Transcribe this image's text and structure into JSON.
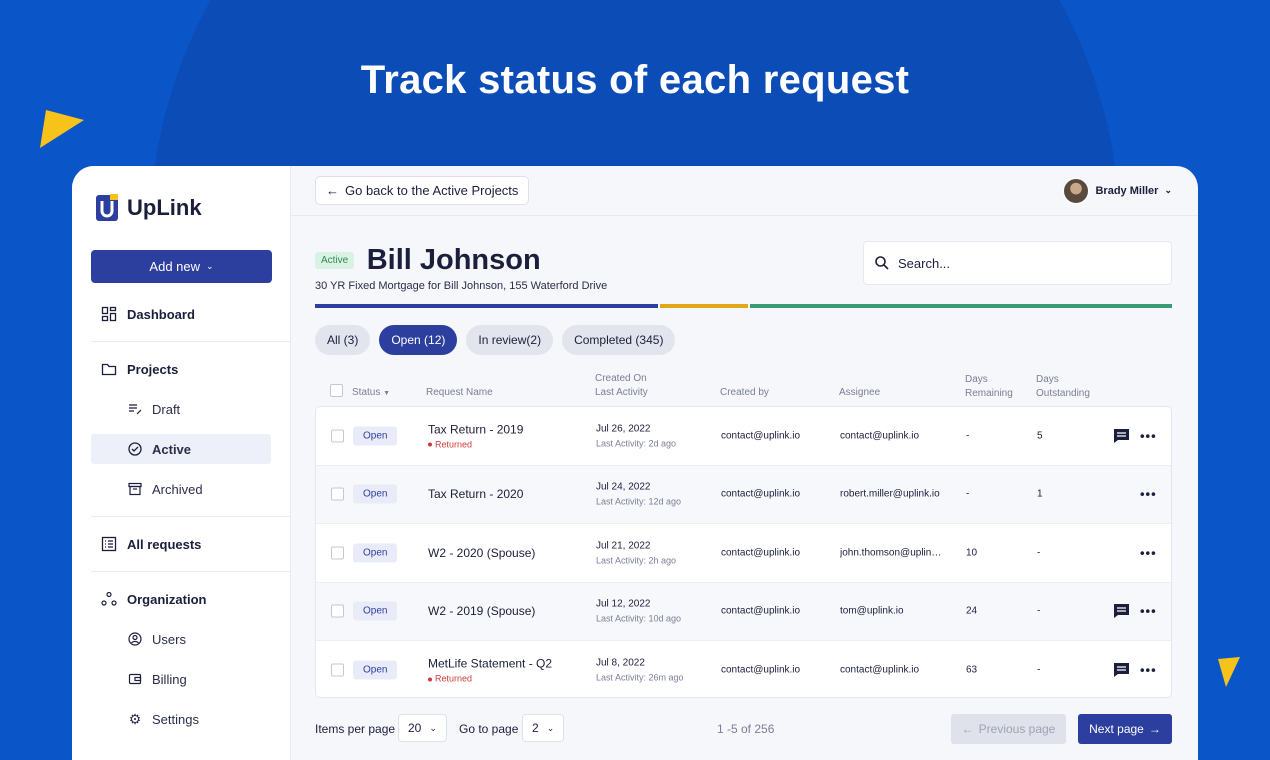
{
  "headline": "Track status of each request",
  "app": {
    "brand": "UpLink",
    "add_new": "Add new",
    "nav": {
      "dashboard": "Dashboard",
      "projects": "Projects",
      "draft": "Draft",
      "active": "Active",
      "archived": "Archived",
      "all_requests": "All requests",
      "organization": "Organization",
      "users": "Users",
      "billing": "Billing",
      "settings": "Settings"
    }
  },
  "topbar": {
    "back_label": "Go back to the Active Projects",
    "user_name": "Brady Miller"
  },
  "project": {
    "status_badge": "Active",
    "client_name": "Bill Johnson",
    "subtitle": "30 YR Fixed Mortgage for Bill Johnson, 155 Waterford Drive"
  },
  "search": {
    "placeholder": "Search..."
  },
  "progress_colors": [
    "#2c3e9e",
    "#e0a817",
    "#3a9a72"
  ],
  "tabs": [
    "All (3)",
    "Open (12)",
    "In review(2)",
    "Completed (345)"
  ],
  "columns": {
    "status": "Status",
    "request_name": "Request Name",
    "created_on": "Created On",
    "last_activity": "Last Activity",
    "created_by": "Created by",
    "assignee": "Assignee",
    "days": "Days",
    "remaining": "Remaining",
    "outstanding": "Outstanding"
  },
  "rows": [
    {
      "status": "Open",
      "name": "Tax Return - 2019",
      "flag": "Returned",
      "created": "Jul 26, 2022",
      "last": "Last Activity: 2d ago",
      "created_by": "contact@uplink.io",
      "assignee": "contact@uplink.io",
      "remaining": "-",
      "outstanding": "5",
      "comment": true
    },
    {
      "status": "Open",
      "name": "Tax Return - 2020",
      "flag": "",
      "created": "Jul 24, 2022",
      "last": "Last Activity: 12d ago",
      "created_by": "contact@uplink.io",
      "assignee": "robert.miller@uplink.io",
      "remaining": "-",
      "outstanding": "1",
      "comment": false
    },
    {
      "status": "Open",
      "name": "W2 - 2020 (Spouse)",
      "flag": "",
      "created": "Jul 21, 2022",
      "last": "Last Activity: 2h ago",
      "created_by": "contact@uplink.io",
      "assignee": "john.thomson@uplink.io",
      "remaining": "10",
      "outstanding": "-",
      "comment": false
    },
    {
      "status": "Open",
      "name": "W2 - 2019 (Spouse)",
      "flag": "",
      "created": "Jul 12, 2022",
      "last": "Last Activity: 10d ago",
      "created_by": "contact@uplink.io",
      "assignee": "tom@uplink.io",
      "remaining": "24",
      "outstanding": "-",
      "comment": true
    },
    {
      "status": "Open",
      "name": "MetLife Statement - Q2",
      "flag": "Returned",
      "created": "Jul 8, 2022",
      "last": "Last Activity: 26m ago",
      "created_by": "contact@uplink.io",
      "assignee": "contact@uplink.io",
      "remaining": "63",
      "outstanding": "-",
      "comment": true
    }
  ],
  "footer": {
    "items_per_page_label": "Items per page",
    "items_per_page": "20",
    "goto_label": "Go to page",
    "goto_value": "2",
    "range": "1 -5 of 256",
    "prev": "Previous page",
    "next": "Next page"
  }
}
